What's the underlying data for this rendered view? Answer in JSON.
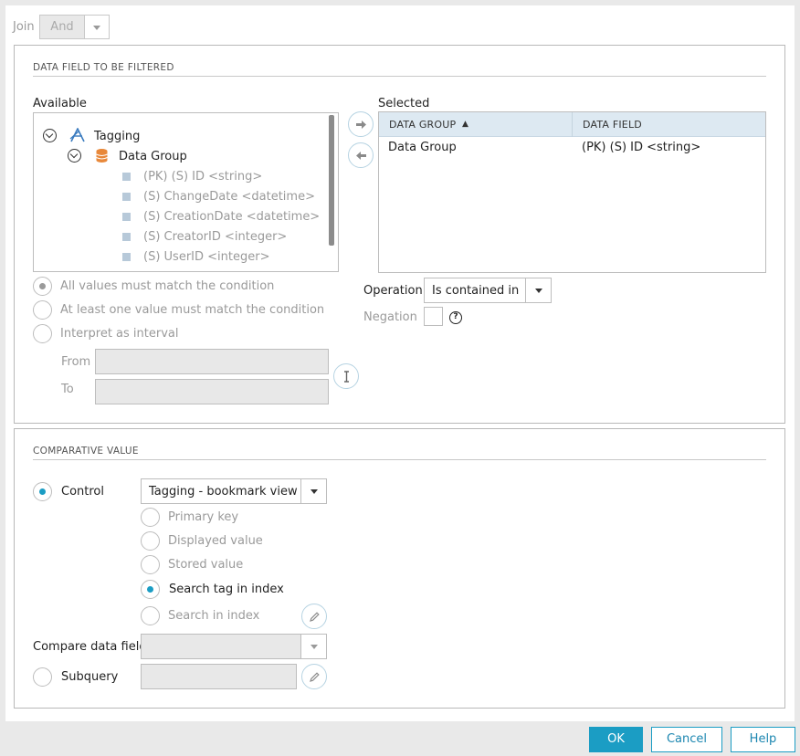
{
  "join": {
    "label": "Join",
    "value": "And"
  },
  "filter_section": {
    "title": "DATA FIELD TO BE FILTERED",
    "available_label": "Available",
    "selected_label": "Selected",
    "tree": {
      "root": "Tagging",
      "group": "Data Group",
      "fields": [
        "(PK) (S) ID <string>",
        "(S) ChangeDate <datetime>",
        "(S) CreationDate <datetime>",
        "(S) CreatorID <integer>",
        "(S) UserID <integer>"
      ]
    },
    "selected_table": {
      "columns": [
        "DATA GROUP",
        "DATA FIELD"
      ],
      "sort_indicator": "▲",
      "rows": [
        {
          "group": "Data Group",
          "field": "(PK) (S) ID <string>"
        }
      ]
    },
    "match_options": [
      "All values must match the condition",
      "At least one value must match the condition",
      "Interpret as interval"
    ],
    "from_label": "From",
    "to_label": "To",
    "operation_label": "Operation",
    "operation_value": "Is contained in",
    "negation_label": "Negation",
    "help_glyph": "?"
  },
  "comparative_section": {
    "title": "COMPARATIVE VALUE",
    "control_label": "Control",
    "control_value": "Tagging - bookmark view",
    "control_options": [
      "Primary key",
      "Displayed value",
      "Stored value",
      "Search tag in index",
      "Search in index"
    ],
    "compare_field_label": "Compare data field",
    "subquery_label": "Subquery"
  },
  "footer": {
    "ok": "OK",
    "cancel": "Cancel",
    "help": "Help"
  },
  "colors": {
    "accent": "#1b9dc4",
    "header_bg": "#dde9f2",
    "disabled_bg": "#e8e8e8"
  }
}
